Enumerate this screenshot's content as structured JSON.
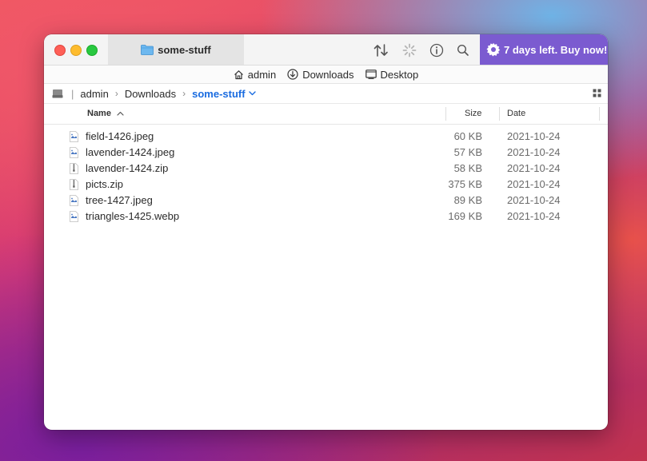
{
  "window": {
    "tab_title": "some-stuff",
    "buy_label": "7 days left. Buy now!"
  },
  "favorites": [
    {
      "label": "admin",
      "icon": "home-icon"
    },
    {
      "label": "Downloads",
      "icon": "download-icon"
    },
    {
      "label": "Desktop",
      "icon": "desktop-icon"
    }
  ],
  "path": {
    "separator": "|",
    "crumbs": [
      "admin",
      "Downloads"
    ],
    "current": "some-stuff"
  },
  "columns": {
    "name": "Name",
    "size": "Size",
    "date": "Date"
  },
  "files": [
    {
      "name": "field-1426.jpeg",
      "size": "60 KB",
      "date": "2021-10-24",
      "kind": "image"
    },
    {
      "name": "lavender-1424.jpeg",
      "size": "57 KB",
      "date": "2021-10-24",
      "kind": "image"
    },
    {
      "name": "lavender-1424.zip",
      "size": "58 KB",
      "date": "2021-10-24",
      "kind": "zip"
    },
    {
      "name": "picts.zip",
      "size": "375 KB",
      "date": "2021-10-24",
      "kind": "zip"
    },
    {
      "name": "tree-1427.jpeg",
      "size": "89 KB",
      "date": "2021-10-24",
      "kind": "image"
    },
    {
      "name": "triangles-1425.webp",
      "size": "169 KB",
      "date": "2021-10-24",
      "kind": "image"
    }
  ],
  "colors": {
    "accent": "#1a6ce0",
    "buy_background": "#7b5bd0"
  }
}
